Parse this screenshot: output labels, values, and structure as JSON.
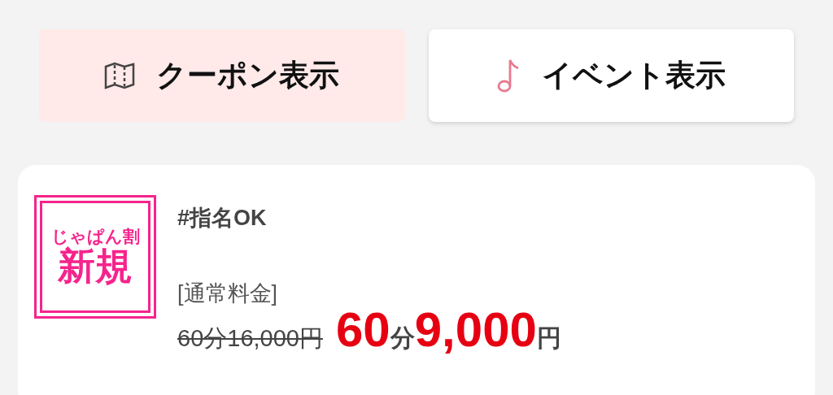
{
  "tabs": [
    {
      "label": "クーポン表示",
      "kind": "map",
      "selected": true
    },
    {
      "label": "イベント表示",
      "kind": "note",
      "selected": false
    }
  ],
  "offer": {
    "badge": {
      "top": "じゃぱん割",
      "main": "新規"
    },
    "tag": "#指名OK",
    "regular_label": "[通常料金]",
    "regular_price": "60分16,000円",
    "price": {
      "minutes": "60",
      "minutes_unit": "分",
      "amount": "9,000",
      "currency": "円"
    }
  }
}
